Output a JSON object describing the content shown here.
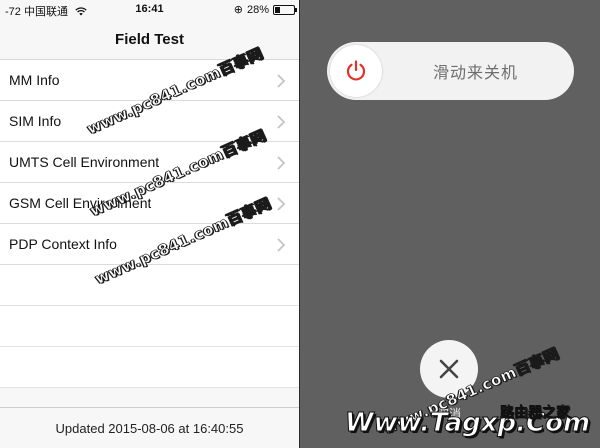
{
  "status_bar": {
    "carrier": "-72 中国联通",
    "time": "16:41",
    "battery_percent_label": "28%",
    "battery_level": 0.28
  },
  "nav": {
    "title": "Field Test"
  },
  "menu": {
    "items": [
      {
        "label": "MM Info"
      },
      {
        "label": "SIM Info"
      },
      {
        "label": "UMTS Cell Environment"
      },
      {
        "label": "GSM Cell Environment"
      },
      {
        "label": "PDP Context Info"
      }
    ]
  },
  "footer": {
    "updated_text": "Updated 2015-08-06 at 16:40:55"
  },
  "power_off": {
    "slider_label": "滑动来关机",
    "cancel_label": "取消",
    "accent_color": "#e0312b"
  },
  "watermarks": {
    "text": "www.pc841.com百事网",
    "brand": "Www.Tagxp.Com",
    "brand_small": "路由器之家"
  },
  "colors": {
    "left_bg": "#f7f7f7",
    "right_bg": "#606060",
    "separator": "#dcdcdc"
  }
}
